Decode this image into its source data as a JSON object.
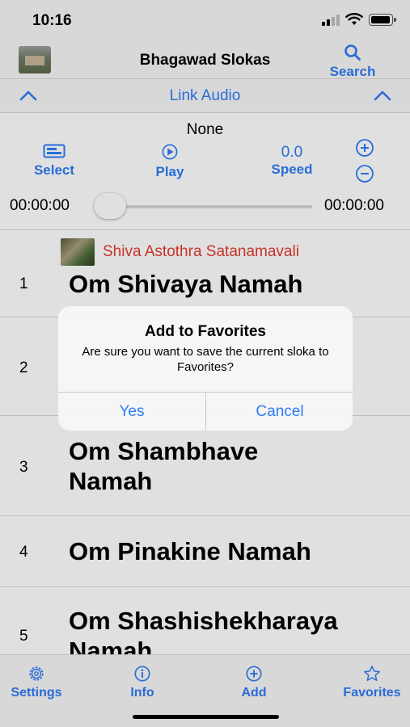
{
  "status_bar": {
    "time": "10:16"
  },
  "nav": {
    "title": "Bhagawad Slokas",
    "search_label": "Search"
  },
  "link_audio": {
    "title": "Link Audio"
  },
  "player": {
    "audio_name": "None",
    "select_label": "Select",
    "play_label": "Play",
    "speed_value": "0.0",
    "speed_label": "Speed",
    "time_start": "00:00:00",
    "time_end": "00:00:00",
    "progress": 0
  },
  "list": {
    "header_title": "Shiva Astothra Satanamavali",
    "rows": [
      {
        "num": "1",
        "text": "Om Shivaya Namah"
      },
      {
        "num": "2",
        "text": ""
      },
      {
        "num": "3",
        "text": "Om Shambhave Namah"
      },
      {
        "num": "4",
        "text": "Om Pinakine Namah"
      },
      {
        "num": "5",
        "text": "Om Shashishekharaya Namah"
      }
    ]
  },
  "tabs": {
    "settings": "Settings",
    "info": "Info",
    "add": "Add",
    "favorites": "Favorites"
  },
  "alert": {
    "title": "Add to Favorites",
    "message": "Are sure you want to save the current sloka to Favorites?",
    "yes_label": "Yes",
    "cancel_label": "Cancel"
  },
  "colors": {
    "accent": "#2f7cf6",
    "header_red": "#e23b2f"
  }
}
